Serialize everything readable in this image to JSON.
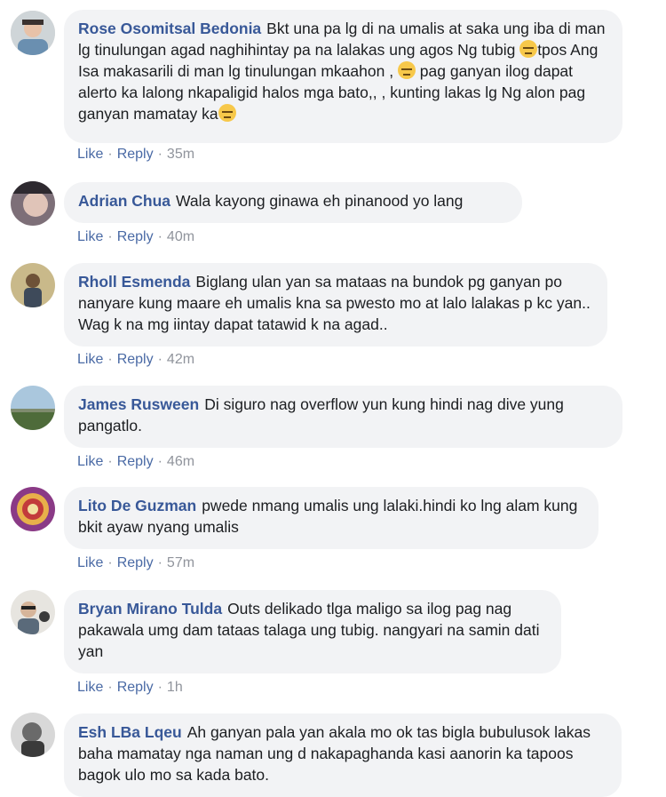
{
  "actions": {
    "like": "Like",
    "reply": "Reply",
    "separator": "·"
  },
  "comments": [
    {
      "author": "Rose Osomitsal Bedonia",
      "text_parts": [
        "Bkt una pa lg di na umalis at saka ung iba di man lg tinulungan agad naghihintay pa na lalakas ung agos Ng tubig ",
        "tpos Ang Isa makasarili di man lg tinulungan mkaahon , ",
        " pag ganyan ilog dapat alerto ka lalong nkapaligid halos mga bato,, , kunting lakas lg Ng alon pag ganyan mamatay ka"
      ],
      "time": "35m"
    },
    {
      "author": "Adrian Chua",
      "text": "Wala kayong ginawa eh pinanood yo lang",
      "time": "40m"
    },
    {
      "author": "Rholl Esmenda",
      "text": "Biglang ulan yan sa mataas na bundok pg ganyan po nanyare kung maare eh umalis kna sa pwesto mo at lalo lalakas p kc yan.. Wag k na mg iintay dapat tatawid k na agad..",
      "time": "42m"
    },
    {
      "author": "James Rusween",
      "text": "Di siguro nag overflow yun kung hindi nag dive yung pangatlo.",
      "time": "46m"
    },
    {
      "author": "Lito De Guzman",
      "text": "pwede nmang umalis ung lalaki.hindi ko lng alam kung bkit ayaw nyang umalis",
      "time": "57m"
    },
    {
      "author": "Bryan Mirano Tulda",
      "text": "Outs delikado tlga maligo sa ilog pag nag pakawala umg dam tataas talaga ung tubig. nangyari na samin dati yan",
      "time": "1h"
    },
    {
      "author": "Esh LBa Lqeu",
      "text": "Ah ganyan pala yan akala mo ok tas bigla bubulusok lakas baha mamatay nga naman ung d nakapaghanda kasi aanorin ka tapoos bagok ulo mo sa kada bato."
    }
  ]
}
